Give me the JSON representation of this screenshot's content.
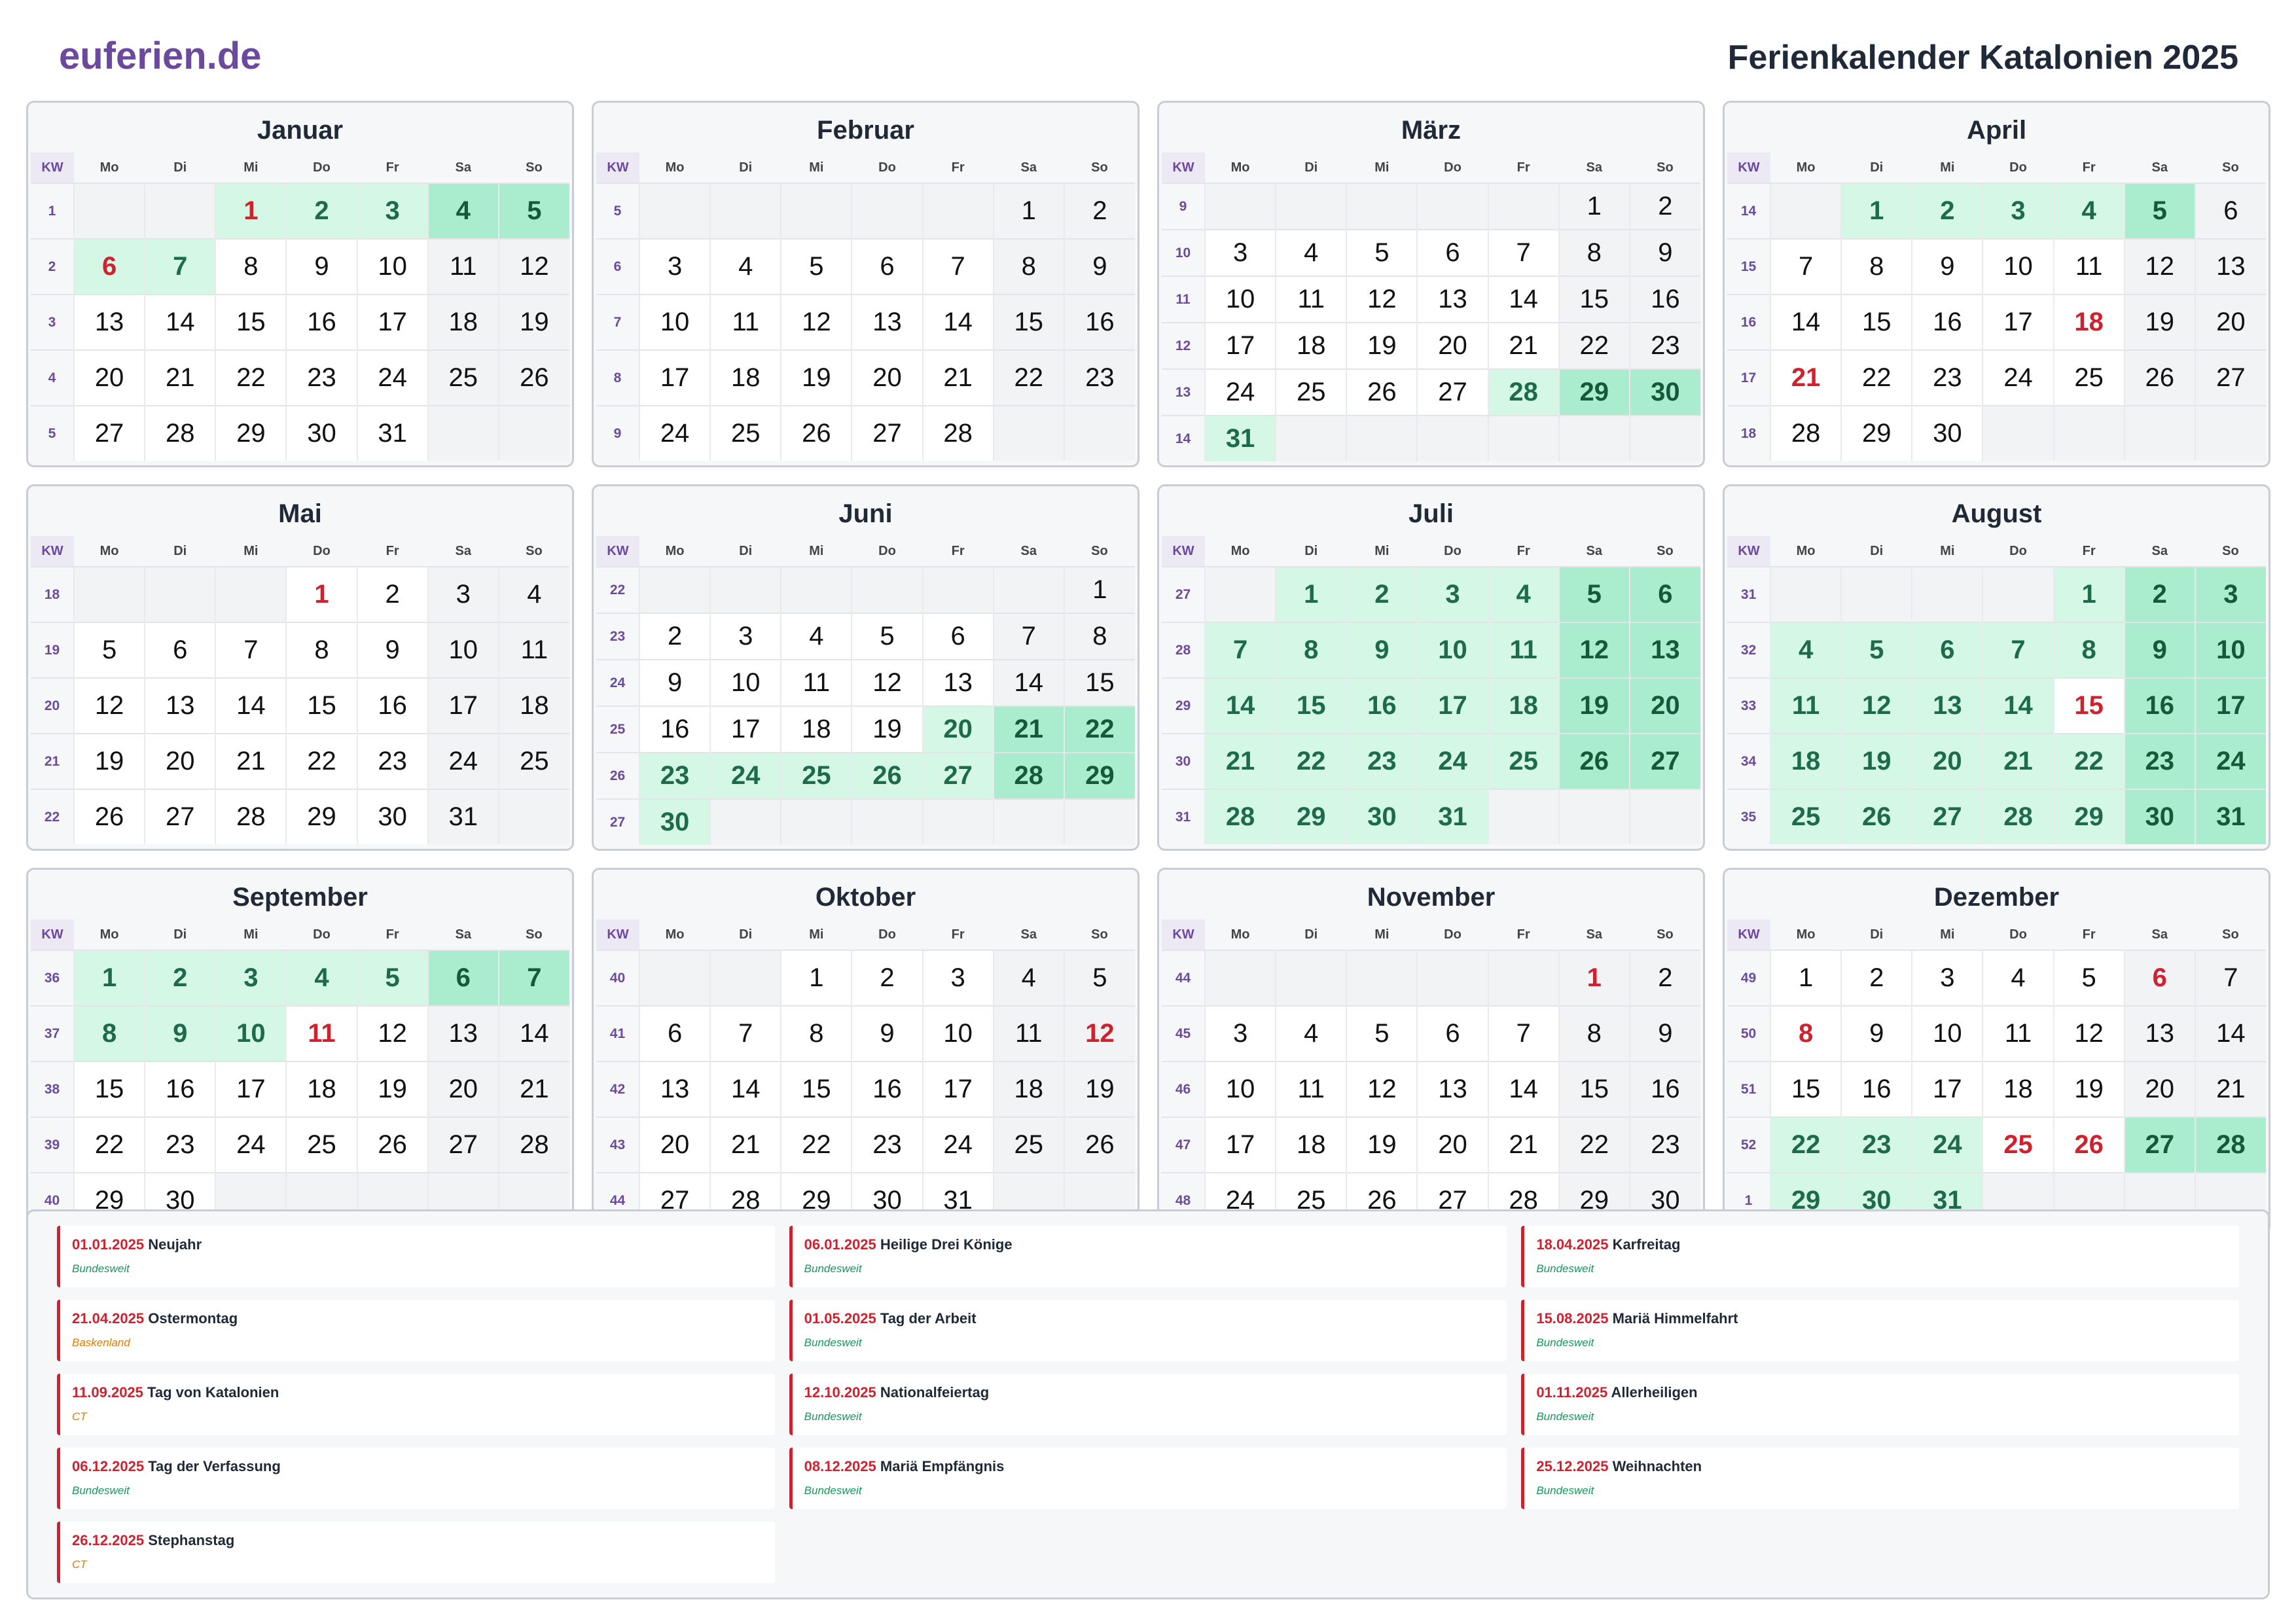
{
  "header": {
    "brand": "euferien.de",
    "title": "Ferienkalender Katalonien 2025"
  },
  "weekday_headers": [
    "KW",
    "Mo",
    "Di",
    "Mi",
    "Do",
    "Fr",
    "Sa",
    "So"
  ],
  "months": [
    {
      "name": "Januar",
      "kw": [
        1,
        2,
        3,
        4,
        5
      ],
      "offset": 2,
      "days": 31,
      "hol": [
        1,
        2,
        3,
        4,
        5,
        6,
        7
      ],
      "ph": [
        1,
        6
      ]
    },
    {
      "name": "Februar",
      "kw": [
        5,
        6,
        7,
        8,
        9
      ],
      "offset": 5,
      "days": 28,
      "hol": [],
      "ph": []
    },
    {
      "name": "März",
      "kw": [
        9,
        10,
        11,
        12,
        13,
        14
      ],
      "offset": 5,
      "days": 31,
      "hol": [
        28,
        29,
        30,
        31
      ],
      "ph": []
    },
    {
      "name": "April",
      "kw": [
        14,
        15,
        16,
        17,
        18
      ],
      "offset": 1,
      "days": 30,
      "hol": [
        1,
        2,
        3,
        4,
        5
      ],
      "ph": [
        18,
        21
      ]
    },
    {
      "name": "Mai",
      "kw": [
        18,
        19,
        20,
        21,
        22
      ],
      "offset": 3,
      "days": 31,
      "hol": [],
      "ph": [
        1
      ]
    },
    {
      "name": "Juni",
      "kw": [
        22,
        23,
        24,
        25,
        26,
        27
      ],
      "offset": 6,
      "days": 30,
      "hol": [
        20,
        21,
        22,
        23,
        24,
        25,
        26,
        27,
        28,
        29,
        30
      ],
      "ph": []
    },
    {
      "name": "Juli",
      "kw": [
        27,
        28,
        29,
        30,
        31
      ],
      "offset": 1,
      "days": 31,
      "hol": [
        1,
        2,
        3,
        4,
        5,
        6,
        7,
        8,
        9,
        10,
        11,
        12,
        13,
        14,
        15,
        16,
        17,
        18,
        19,
        20,
        21,
        22,
        23,
        24,
        25,
        26,
        27,
        28,
        29,
        30,
        31
      ],
      "ph": []
    },
    {
      "name": "August",
      "kw": [
        31,
        32,
        33,
        34,
        35
      ],
      "offset": 4,
      "days": 31,
      "hol": [
        1,
        2,
        3,
        4,
        5,
        6,
        7,
        8,
        9,
        10,
        11,
        12,
        13,
        14,
        16,
        17,
        18,
        19,
        20,
        21,
        22,
        23,
        24,
        25,
        26,
        27,
        28,
        29,
        30,
        31
      ],
      "ph": [
        15
      ]
    },
    {
      "name": "September",
      "kw": [
        36,
        37,
        38,
        39,
        40
      ],
      "offset": 0,
      "days": 30,
      "hol": [
        1,
        2,
        3,
        4,
        5,
        6,
        7,
        8,
        9,
        10
      ],
      "ph": [
        11
      ]
    },
    {
      "name": "Oktober",
      "kw": [
        40,
        41,
        42,
        43,
        44
      ],
      "offset": 2,
      "days": 31,
      "hol": [],
      "ph": [
        12
      ]
    },
    {
      "name": "November",
      "kw": [
        44,
        45,
        46,
        47,
        48
      ],
      "offset": 5,
      "days": 30,
      "hol": [],
      "ph": [
        1
      ]
    },
    {
      "name": "Dezember",
      "kw": [
        49,
        50,
        51,
        52,
        1
      ],
      "offset": 0,
      "days": 31,
      "hol": [
        22,
        23,
        24,
        27,
        28,
        29,
        30,
        31
      ],
      "ph": [
        6,
        8,
        25,
        26
      ]
    }
  ],
  "holidays": [
    {
      "date": "01.01.2025",
      "name": "Neujahr",
      "region": "Bundesweit",
      "type": "bw"
    },
    {
      "date": "06.01.2025",
      "name": "Heilige Drei Könige",
      "region": "Bundesweit",
      "type": "bw"
    },
    {
      "date": "18.04.2025",
      "name": "Karfreitag",
      "region": "Bundesweit",
      "type": "bw"
    },
    {
      "date": "21.04.2025",
      "name": "Ostermontag",
      "region": "Baskenland",
      "type": "reg"
    },
    {
      "date": "01.05.2025",
      "name": "Tag der Arbeit",
      "region": "Bundesweit",
      "type": "bw"
    },
    {
      "date": "15.08.2025",
      "name": "Mariä Himmelfahrt",
      "region": "Bundesweit",
      "type": "bw"
    },
    {
      "date": "11.09.2025",
      "name": "Tag von Katalonien",
      "region": "CT",
      "type": "reg"
    },
    {
      "date": "12.10.2025",
      "name": "Nationalfeiertag",
      "region": "Bundesweit",
      "type": "bw"
    },
    {
      "date": "01.11.2025",
      "name": "Allerheiligen",
      "region": "Bundesweit",
      "type": "bw"
    },
    {
      "date": "06.12.2025",
      "name": "Tag der Verfassung",
      "region": "Bundesweit",
      "type": "bw"
    },
    {
      "date": "08.12.2025",
      "name": "Mariä Empfängnis",
      "region": "Bundesweit",
      "type": "bw"
    },
    {
      "date": "25.12.2025",
      "name": "Weihnachten",
      "region": "Bundesweit",
      "type": "bw"
    },
    {
      "date": "26.12.2025",
      "name": "Stephanstag",
      "region": "CT",
      "type": "reg"
    }
  ]
}
